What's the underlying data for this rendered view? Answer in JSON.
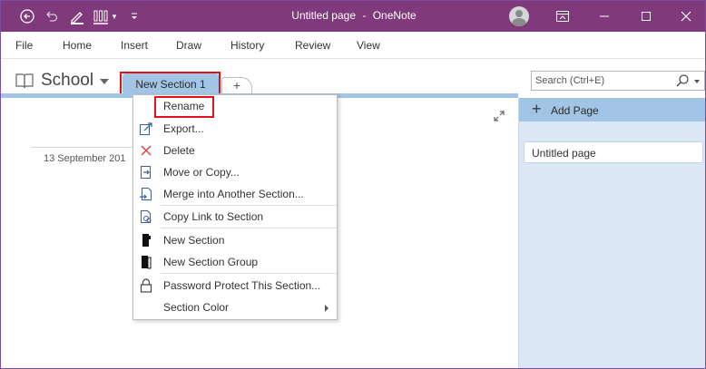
{
  "window": {
    "title_page": "Untitled page",
    "title_separator": "-",
    "title_app": "OneNote"
  },
  "menubar": {
    "items": [
      {
        "label": "File"
      },
      {
        "label": "Home"
      },
      {
        "label": "Insert"
      },
      {
        "label": "Draw"
      },
      {
        "label": "History"
      },
      {
        "label": "Review"
      },
      {
        "label": "View"
      }
    ]
  },
  "notebook": {
    "name": "School",
    "section_tab": "New Section 1",
    "add_section": "+"
  },
  "search": {
    "placeholder": "Search (Ctrl+E)"
  },
  "page": {
    "date": "13 September 201"
  },
  "pages_pane": {
    "add_page_label": "Add Page",
    "pages": [
      {
        "title": "Untitled page"
      }
    ]
  },
  "context_menu": {
    "rename": "Rename",
    "export": "Export...",
    "delete": "Delete",
    "move_copy": "Move or Copy...",
    "merge": "Merge into Another Section...",
    "copy_link": "Copy Link to Section",
    "new_section": "New Section",
    "new_section_group": "New Section Group",
    "password": "Password Protect This Section...",
    "section_color": "Section Color"
  },
  "colors": {
    "titlebar": "#80397b",
    "section_tab": "#a2c4e5",
    "pane": "#dbe7f5",
    "highlight_outline": "#e0121a"
  },
  "icons": {
    "back": "back-arrow-icon",
    "undo": "undo-icon",
    "pen": "pen-icon",
    "pen_set": "pen-set-icon",
    "customize": "customize-toolbar-icon",
    "restore": "ribbon-display-icon",
    "minimize": "minimize-icon",
    "maximize": "maximize-icon",
    "close": "close-icon"
  }
}
